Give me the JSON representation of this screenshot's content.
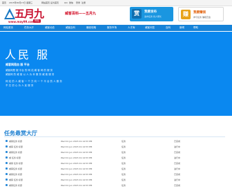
{
  "topbar": {
    "items": [
      "首页",
      "2015年06月17日 星期三",
      "网站首页 设为首页",
      "QQ",
      "微信",
      "登录",
      "注册"
    ]
  },
  "logo": {
    "text": "五月九",
    "url": "www.may99.com",
    "badge": "网站"
  },
  "header": {
    "slogan": "威客百科——五月九"
  },
  "promos": [
    {
      "icon": "赏",
      "title": "我要发布",
      "sub": "发布任务 找人帮忙"
    },
    {
      "icon": "赚",
      "title": "我要赚钱",
      "sub": "参与任务 赚取赏金"
    }
  ],
  "nav": {
    "items": [
      "网站首页",
      "任务大厅",
      "威客动态",
      "威客百科",
      "赚钱攻略",
      "服务市场",
      "人才库",
      "威客问答",
      "百科",
      "新闻",
      "帮助"
    ]
  },
  "banner": {
    "title": "人民 服",
    "tag": "威客网是由 服 平台",
    "lines": [
      "威客网是 服 平台 的 网 站 威 客 网 的 服 务",
      "威客网 的 威 客 以 人 为 本 服 务 威 客 服 务",
      "网 站 的 人 威 客 一 个 方 向 一 个 平 台 的 人 服 务",
      "不 忘 初 心 为 人 民 服 务"
    ]
  },
  "tasks": {
    "section_title": "任务悬赏大厅",
    "rows": [
      [
        "威客任务 标题",
        "Wed 01 Jun 2015 01:14:53 PM",
        "任务",
        "已完成"
      ],
      [
        "威客 任务 标题",
        "Wed 01 Jun 2015 01:14:53 PM",
        "任务",
        "进行中"
      ],
      [
        "威客任务 标题",
        "Wed 01 Jun 2015 01:14:53 PM",
        "任务",
        "已完成"
      ],
      [
        "威 任务 标题",
        "Wed 01 Jun 2015 01:14:53 PM",
        "任务",
        "进行中"
      ],
      [
        "威客 任务 标题",
        "Wed 01 Jun 2015 01:14:53 PM",
        "任务",
        "已完成"
      ],
      [
        "威客任务 标题",
        "Wed 01 Jun 2015 01:14:53 PM",
        "任务",
        "进行中"
      ],
      [
        "威客任务 标题",
        "Wed 01 Jun 2015 01:14:53 PM",
        "任务",
        "已完成"
      ],
      [
        "威客 任务 标题",
        "Wed 01 Jun 2015 01:14:53 PM",
        "任务",
        "进行中"
      ],
      [
        "威客任务 标题",
        "Wed 01 Jun 2015 01:14:53 PM",
        "任务",
        "已完成"
      ]
    ]
  },
  "colors": {
    "brand": "#c8102e",
    "nav": "#1582d8",
    "banner": "#0a88f0",
    "section": "#1a7ed0"
  }
}
